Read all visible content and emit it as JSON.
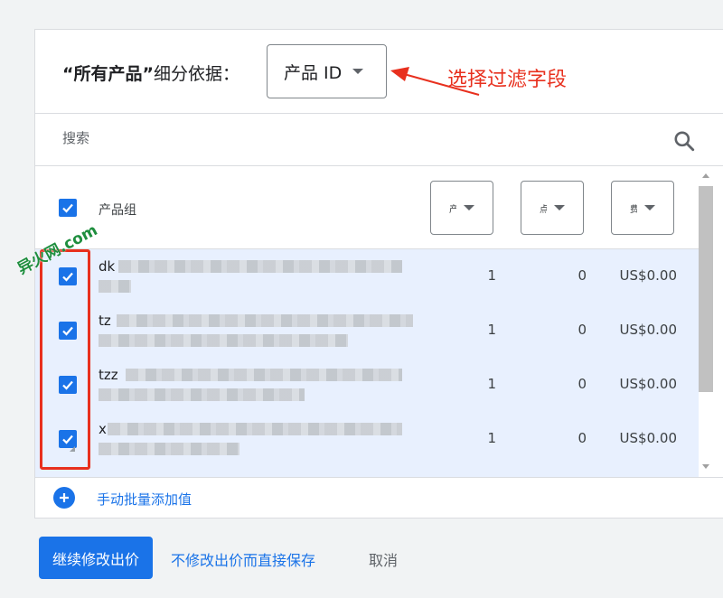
{
  "header": {
    "title_quoted": "“所有产品”",
    "title_suffix": "细分依据：",
    "dimension_value": "产品 ID"
  },
  "annotation": {
    "text": "选择过滤字段",
    "color": "#e8301e"
  },
  "search": {
    "placeholder": "搜索"
  },
  "table": {
    "column_label": "产品组",
    "columns": [
      {
        "label": "产"
      },
      {
        "label": "点"
      },
      {
        "label": "费"
      }
    ],
    "rows": [
      {
        "name": "dk",
        "qty": "1",
        "conv": "0",
        "cost": "US$0.00",
        "checked": true
      },
      {
        "name": "tz",
        "qty": "1",
        "conv": "0",
        "cost": "US$0.00",
        "checked": true
      },
      {
        "name": "tzz",
        "qty": "1",
        "conv": "0",
        "cost": "US$0.00",
        "checked": true
      },
      {
        "name": "x",
        "qty": "1",
        "conv": "0",
        "cost": "US$0.00",
        "checked": true
      }
    ]
  },
  "add_values": {
    "label": "手动批量添加值"
  },
  "watermark": {
    "text": "异火网.com"
  },
  "footer": {
    "continue_label": "继续修改出价",
    "save_label": "不修改出价而直接保存",
    "cancel_label": "取消"
  },
  "colors": {
    "accent": "#1a73e8",
    "selected_row_bg": "#e8f0fe",
    "annotation_red": "#e8301e",
    "watermark_green": "#1e8e3e"
  }
}
